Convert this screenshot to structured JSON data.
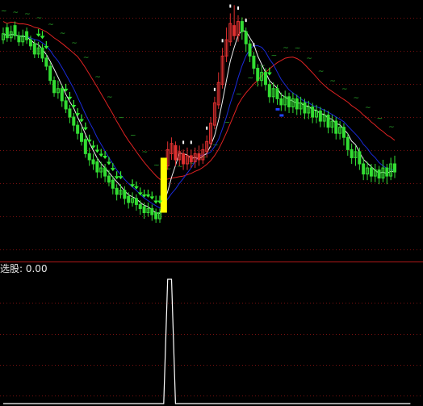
{
  "sub_panel": {
    "label": "选股: ",
    "value": "0.00"
  },
  "colors": {
    "background": "#000000",
    "up_candle": "#e03030",
    "down_candle": "#33dd33",
    "long_ma": "#dd2222",
    "mid_ma": "#1a2ad8",
    "short_ma": "#f0f0f0",
    "signal_bar": "#ffff00",
    "grid": "#7a1010",
    "tilde": "#2aa82a",
    "arrow": "#33ee33",
    "white_mark": "#ffffff",
    "blue_mark": "#2244ff",
    "sub_line": "#ffffff"
  },
  "chart_data": [
    {
      "type": "candlestick",
      "title": "",
      "grid": true,
      "ylim": [
        0,
        100
      ],
      "candles": [
        {
          "o": 86,
          "c": 89,
          "h": 92,
          "l": 84
        },
        {
          "o": 92,
          "c": 87,
          "h": 94,
          "l": 85
        },
        {
          "o": 87,
          "c": 90,
          "h": 93,
          "l": 85
        },
        {
          "o": 93,
          "c": 88,
          "h": 95,
          "l": 86
        },
        {
          "o": 88,
          "c": 85,
          "h": 90,
          "l": 83
        },
        {
          "o": 85,
          "c": 88,
          "h": 91,
          "l": 83
        },
        {
          "o": 90,
          "c": 86,
          "h": 92,
          "l": 84
        },
        {
          "o": 86,
          "c": 83,
          "h": 88,
          "l": 81
        },
        {
          "o": 84,
          "c": 79,
          "h": 86,
          "l": 77
        },
        {
          "o": 79,
          "c": 82,
          "h": 85,
          "l": 77
        },
        {
          "o": 82,
          "c": 77,
          "h": 84,
          "l": 75
        },
        {
          "o": 77,
          "c": 73,
          "h": 79,
          "l": 71
        },
        {
          "o": 73,
          "c": 66,
          "h": 75,
          "l": 64
        },
        {
          "o": 66,
          "c": 60,
          "h": 68,
          "l": 58
        },
        {
          "o": 60,
          "c": 62,
          "h": 66,
          "l": 57
        },
        {
          "o": 62,
          "c": 56,
          "h": 64,
          "l": 53
        },
        {
          "o": 56,
          "c": 52,
          "h": 58,
          "l": 50
        },
        {
          "o": 52,
          "c": 48,
          "h": 54,
          "l": 45
        },
        {
          "o": 48,
          "c": 44,
          "h": 50,
          "l": 41
        },
        {
          "o": 44,
          "c": 40,
          "h": 46,
          "l": 37
        },
        {
          "o": 40,
          "c": 36,
          "h": 43,
          "l": 34
        },
        {
          "o": 37,
          "c": 30,
          "h": 39,
          "l": 28
        },
        {
          "o": 30,
          "c": 27,
          "h": 33,
          "l": 24
        },
        {
          "o": 27,
          "c": 25,
          "h": 30,
          "l": 22
        },
        {
          "o": 26,
          "c": 21,
          "h": 28,
          "l": 18
        },
        {
          "o": 21,
          "c": 23,
          "h": 26,
          "l": 18
        },
        {
          "o": 23,
          "c": 19,
          "h": 25,
          "l": 16
        },
        {
          "o": 19,
          "c": 16,
          "h": 22,
          "l": 14
        },
        {
          "o": 17,
          "c": 13,
          "h": 19,
          "l": 10
        },
        {
          "o": 13,
          "c": 10,
          "h": 15,
          "l": 7
        },
        {
          "o": 10,
          "c": 12,
          "h": 15,
          "l": 8
        },
        {
          "o": 12,
          "c": 8,
          "h": 14,
          "l": 5
        },
        {
          "o": 9,
          "c": 6,
          "h": 11,
          "l": 3
        },
        {
          "o": 6,
          "c": 8,
          "h": 11,
          "l": 4
        },
        {
          "o": 8,
          "c": 5,
          "h": 10,
          "l": 2
        },
        {
          "o": 5,
          "c": 3,
          "h": 7,
          "l": 0
        },
        {
          "o": 4,
          "c": 1,
          "h": 6,
          "l": -2
        },
        {
          "o": 1,
          "c": 3,
          "h": 6,
          "l": -1
        },
        {
          "o": 3,
          "c": 0,
          "h": 5,
          "l": -3
        },
        {
          "o": 1,
          "c": -2,
          "h": 3,
          "l": -4
        },
        {
          "o": -2,
          "c": 1,
          "h": 3,
          "l": -4
        },
        {
          "o": 2,
          "c": 26,
          "h": 28,
          "l": 1
        },
        {
          "o": 24,
          "c": 32,
          "h": 36,
          "l": 22
        },
        {
          "o": 30,
          "c": 35,
          "h": 38,
          "l": 27
        },
        {
          "o": 34,
          "c": 27,
          "h": 36,
          "l": 24
        },
        {
          "o": 27,
          "c": 31,
          "h": 34,
          "l": 24
        },
        {
          "o": 30,
          "c": 25,
          "h": 32,
          "l": 22
        },
        {
          "o": 25,
          "c": 29,
          "h": 33,
          "l": 22
        },
        {
          "o": 29,
          "c": 26,
          "h": 32,
          "l": 23
        },
        {
          "o": 26,
          "c": 30,
          "h": 33,
          "l": 23
        },
        {
          "o": 30,
          "c": 27,
          "h": 34,
          "l": 24
        },
        {
          "o": 27,
          "c": 32,
          "h": 35,
          "l": 25
        },
        {
          "o": 31,
          "c": 36,
          "h": 39,
          "l": 28
        },
        {
          "o": 35,
          "c": 45,
          "h": 48,
          "l": 33
        },
        {
          "o": 44,
          "c": 55,
          "h": 58,
          "l": 42
        },
        {
          "o": 54,
          "c": 65,
          "h": 70,
          "l": 52
        },
        {
          "o": 64,
          "c": 78,
          "h": 82,
          "l": 62
        },
        {
          "o": 78,
          "c": 86,
          "h": 92,
          "l": 75
        },
        {
          "o": 85,
          "c": 94,
          "h": 99,
          "l": 83
        },
        {
          "o": 93,
          "c": 88,
          "h": 103,
          "l": 86
        },
        {
          "o": 88,
          "c": 95,
          "h": 98,
          "l": 85
        },
        {
          "o": 95,
          "c": 90,
          "h": 97,
          "l": 86
        },
        {
          "o": 90,
          "c": 84,
          "h": 92,
          "l": 80
        },
        {
          "o": 84,
          "c": 78,
          "h": 86,
          "l": 75
        },
        {
          "o": 78,
          "c": 72,
          "h": 80,
          "l": 69
        },
        {
          "o": 72,
          "c": 66,
          "h": 74,
          "l": 63
        },
        {
          "o": 66,
          "c": 70,
          "h": 73,
          "l": 63
        },
        {
          "o": 70,
          "c": 64,
          "h": 72,
          "l": 61
        },
        {
          "o": 64,
          "c": 58,
          "h": 66,
          "l": 55
        },
        {
          "o": 58,
          "c": 62,
          "h": 65,
          "l": 55
        },
        {
          "o": 62,
          "c": 57,
          "h": 64,
          "l": 54
        },
        {
          "o": 57,
          "c": 54,
          "h": 60,
          "l": 51
        },
        {
          "o": 54,
          "c": 58,
          "h": 61,
          "l": 51
        },
        {
          "o": 58,
          "c": 53,
          "h": 60,
          "l": 50
        },
        {
          "o": 53,
          "c": 57,
          "h": 60,
          "l": 50
        },
        {
          "o": 57,
          "c": 52,
          "h": 59,
          "l": 49
        },
        {
          "o": 52,
          "c": 55,
          "h": 58,
          "l": 49
        },
        {
          "o": 55,
          "c": 50,
          "h": 57,
          "l": 47
        },
        {
          "o": 50,
          "c": 53,
          "h": 56,
          "l": 47
        },
        {
          "o": 53,
          "c": 48,
          "h": 55,
          "l": 45
        },
        {
          "o": 48,
          "c": 51,
          "h": 54,
          "l": 45
        },
        {
          "o": 51,
          "c": 46,
          "h": 53,
          "l": 43
        },
        {
          "o": 46,
          "c": 49,
          "h": 52,
          "l": 43
        },
        {
          "o": 49,
          "c": 43,
          "h": 51,
          "l": 40
        },
        {
          "o": 43,
          "c": 46,
          "h": 49,
          "l": 40
        },
        {
          "o": 46,
          "c": 40,
          "h": 48,
          "l": 37
        },
        {
          "o": 40,
          "c": 43,
          "h": 46,
          "l": 37
        },
        {
          "o": 43,
          "c": 38,
          "h": 45,
          "l": 34
        },
        {
          "o": 38,
          "c": 32,
          "h": 40,
          "l": 29
        },
        {
          "o": 32,
          "c": 28,
          "h": 35,
          "l": 25
        },
        {
          "o": 28,
          "c": 31,
          "h": 34,
          "l": 24
        },
        {
          "o": 31,
          "c": 25,
          "h": 33,
          "l": 22
        },
        {
          "o": 25,
          "c": 20,
          "h": 28,
          "l": 17
        },
        {
          "o": 20,
          "c": 23,
          "h": 26,
          "l": 17
        },
        {
          "o": 23,
          "c": 19,
          "h": 25,
          "l": 16
        },
        {
          "o": 19,
          "c": 22,
          "h": 25,
          "l": 16
        },
        {
          "o": 22,
          "c": 18,
          "h": 24,
          "l": 15
        },
        {
          "o": 18,
          "c": 23,
          "h": 27,
          "l": 16
        },
        {
          "o": 23,
          "c": 19,
          "h": 25,
          "l": 15
        },
        {
          "o": 19,
          "c": 25,
          "h": 28,
          "l": 17
        },
        {
          "o": 25,
          "c": 21,
          "h": 29,
          "l": 18
        }
      ],
      "red_candles_from": 41,
      "red_candles_to": 60,
      "signal_bar_index": 41,
      "arrow_candles": [
        9,
        10,
        11,
        16,
        17,
        18,
        19,
        20,
        21,
        22,
        23,
        24,
        25,
        26,
        27,
        28,
        29,
        30,
        33,
        34,
        35,
        36,
        37,
        38,
        39,
        40,
        68
      ],
      "white_mark_candles": [
        46,
        48,
        52,
        54,
        56,
        58,
        60,
        62,
        64
      ],
      "blue_mark_candles": [
        70,
        71
      ]
    },
    {
      "type": "line",
      "title": "",
      "grid": true,
      "ylim": [
        0,
        1
      ],
      "x": [
        0,
        40,
        41,
        42,
        43,
        44,
        104
      ],
      "values": [
        0,
        0,
        0,
        1,
        1,
        0,
        0
      ]
    }
  ]
}
